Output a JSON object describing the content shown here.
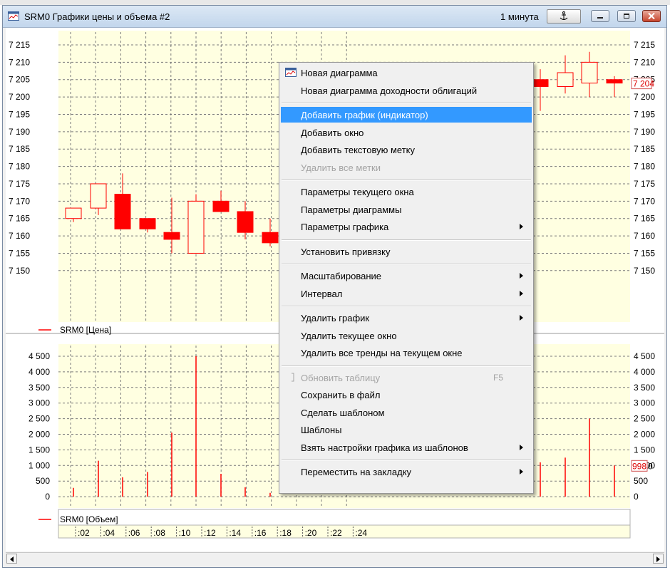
{
  "window": {
    "title": "SRM0 Графики цены и объема #2",
    "interval": "1 минута"
  },
  "price_pane": {
    "legend": "SRM0 [Цена]",
    "y_ticks": [
      "7 215",
      "7 210",
      "7 205",
      "7 200",
      "7 195",
      "7 190",
      "7 185",
      "7 180",
      "7 175",
      "7 170",
      "7 165",
      "7 160",
      "7 155",
      "7 150"
    ],
    "last_price_label": "7 204"
  },
  "volume_pane": {
    "legend": "SRM0 [Объем]",
    "y_ticks": [
      "4 500",
      "4 000",
      "3 500",
      "3 000",
      "2 500",
      "2 000",
      "1 500",
      "1 000",
      "500",
      "0"
    ],
    "last_volume_label": "998",
    "last_volume_suffix": "0"
  },
  "time_axis": {
    "labels": [
      ":02",
      ":04",
      ":06",
      ":08",
      ":10",
      ":12",
      ":14",
      ":16",
      ":18",
      ":20",
      ":22",
      ":24"
    ]
  },
  "chart_data": [
    {
      "type": "candlestick",
      "series": [
        {
          "name": "SRM0 [Цена]"
        }
      ],
      "ylim": [
        7148,
        7218
      ],
      "candles": [
        {
          "o": 7165,
          "h": 7168,
          "l": 7164,
          "c": 7168
        },
        {
          "o": 7168,
          "h": 7175,
          "l": 7166,
          "c": 7175
        },
        {
          "o": 7172,
          "h": 7178,
          "l": 7162,
          "c": 7162
        },
        {
          "o": 7165,
          "h": 7165,
          "l": 7161,
          "c": 7162
        },
        {
          "o": 7161,
          "h": 7171,
          "l": 7155,
          "c": 7159
        },
        {
          "o": 7155,
          "h": 7172,
          "l": 7155,
          "c": 7170
        },
        {
          "o": 7170,
          "h": 7173,
          "l": 7167,
          "c": 7167
        },
        {
          "o": 7167,
          "h": 7170,
          "l": 7159,
          "c": 7161
        },
        {
          "o": 7161,
          "h": 7165,
          "l": 7157,
          "c": 7158
        },
        {
          "o": 7205,
          "h": 7208,
          "l": 7196,
          "c": 7203
        },
        {
          "o": 7203,
          "h": 7212,
          "l": 7201,
          "c": 7207
        },
        {
          "o": 7204,
          "h": 7213,
          "l": 7200,
          "c": 7210
        },
        {
          "o": 7205,
          "h": 7206,
          "l": 7200,
          "c": 7204
        }
      ]
    },
    {
      "type": "bar",
      "series": [
        {
          "name": "SRM0 [Объем]"
        }
      ],
      "ylim": [
        0,
        4500
      ],
      "values": [
        280,
        1150,
        620,
        790,
        2050,
        4500,
        730,
        300,
        120,
        1100,
        1250,
        2500,
        998
      ]
    }
  ],
  "context_menu": {
    "items": [
      {
        "label": "Новая диаграмма",
        "icon": "chart-window-icon"
      },
      {
        "label": "Новая диаграмма доходности облигаций"
      },
      {
        "sep": true
      },
      {
        "label": "Добавить график (индикатор)",
        "highlight": true
      },
      {
        "label": "Добавить окно"
      },
      {
        "label": "Добавить текстовую метку"
      },
      {
        "label": "Удалить все метки",
        "disabled": true
      },
      {
        "sep": true
      },
      {
        "label": "Параметры текущего окна"
      },
      {
        "label": "Параметры диаграммы"
      },
      {
        "label": "Параметры графика",
        "submenu": true
      },
      {
        "sep": true
      },
      {
        "label": "Установить привязку"
      },
      {
        "sep": true
      },
      {
        "label": "Масштабирование",
        "submenu": true
      },
      {
        "label": "Интервал",
        "submenu": true
      },
      {
        "sep": true
      },
      {
        "label": "Удалить график",
        "submenu": true
      },
      {
        "label": "Удалить текущее окно"
      },
      {
        "label": "Удалить все тренды на текущем окне"
      },
      {
        "sep": true
      },
      {
        "label": "Обновить таблицу",
        "disabled": true,
        "shortcut": "F5",
        "icon": "refresh-icon"
      },
      {
        "label": "Сохранить в файл"
      },
      {
        "label": "Сделать шаблоном"
      },
      {
        "label": "Шаблоны"
      },
      {
        "label": "Взять настройки графика из шаблонов",
        "submenu": true
      },
      {
        "sep": true
      },
      {
        "label": "Переместить на закладку",
        "submenu": true
      }
    ]
  },
  "colors": {
    "bear": "#ff0000",
    "bull_outline": "#ff0000",
    "pane_bg": "#ffffe1",
    "grid": "#7a7a7a",
    "highlight": "#3399ff"
  }
}
